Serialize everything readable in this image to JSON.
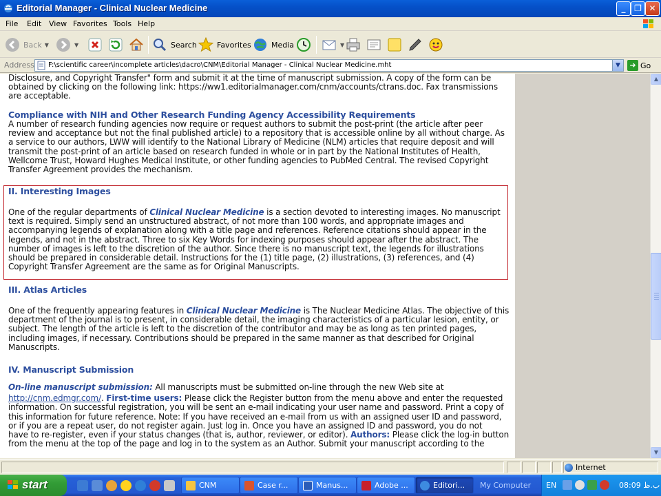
{
  "window": {
    "title": "Editorial Manager - Clinical Nuclear Medicine",
    "min_glyph": "_",
    "max_glyph": "❐",
    "close_glyph": "✕"
  },
  "menu": [
    "File",
    "Edit",
    "View",
    "Favorites",
    "Tools",
    "Help"
  ],
  "toolbar": {
    "back": "Back",
    "search": "Search",
    "favorites": "Favorites",
    "media": "Media"
  },
  "address": {
    "label": "Address",
    "url": "F:\\scientific career\\incomplete articles\\dacro\\CNM\\Editorial Manager - Clinical Nuclear Medicine.mht",
    "go": "Go"
  },
  "content": {
    "intro_lines": [
      "Disclosure, and Copyright Transfer\" form and submit it at the time of manuscript submission. A copy of the form can be",
      "obtained by clicking on the following link: https://ww1.editorialmanager.com/cnm/accounts/ctrans.doc. Fax transmissions",
      "are acceptable."
    ],
    "compliance": {
      "heading": "Compliance with NIH and Other Research Funding Agency Accessibility Requirements",
      "lines": [
        "A number of research funding agencies now require or request authors to submit the post-print (the article after peer",
        "review and acceptance but not the final published article) to a repository that is accessible online by all without charge. As",
        "a service to our authors, LWW will identify to the National Library of Medicine (NLM) articles that require deposit and will",
        "transmit the post-print of an article based on research funded in whole or in part by the National Institutes of Health,",
        "Wellcome Trust, Howard Hughes Medical Institute, or other funding agencies to PubMed Central. The revised Copyright",
        "Transfer Agreement provides the mechanism."
      ]
    },
    "interesting": {
      "heading": "II. Interesting Images",
      "first_pre": "One of the regular departments of ",
      "journal": "Clinical Nuclear Medicine",
      "first_post": " is a section devoted to interesting images. No manuscript",
      "lines": [
        "text is required. Simply send an unstructured abstract, of not more than 100 words, and appropriate images and",
        "accompanying legends of explanation along with a title page and references. Reference citations should appear in the",
        "legends, and not in the abstract. Three to six Key Words for indexing purposes should appear after the abstract. The",
        "number of images is left to the discretion of the author. Since there is no manuscript text, the legends for illustrations",
        "should be prepared in considerable detail. Instructions for the (1) title page, (2) illustrations, (3) references, and (4)",
        "Copyright Transfer Agreement are the same as for Original Manuscripts."
      ]
    },
    "atlas": {
      "heading": "III. Atlas Articles",
      "first_pre": "One of the frequently appearing features in ",
      "journal": "Clinical Nuclear Medicine",
      "first_post": " is The Nuclear Medicine Atlas. The objective of this",
      "lines": [
        "department of the journal is to present, in considerable detail, the imaging characteristics of a particular lesion, entity, or",
        "subject. The length of the article is left to the discretion of the contributor and may be as long as ten printed pages,",
        "including images, if necessary. Contributions should be prepared in the same manner as that described for Original",
        "Manuscripts."
      ]
    },
    "submission": {
      "heading": "IV. Manuscript Submission",
      "online_label": "On-line manuscript submission:",
      "online_text": " All manuscripts must be submitted on-line through the new Web site at",
      "url": "http://cnm.edmgr.com/",
      "first_time_pre": ". ",
      "first_time_label": "First-time users:",
      "first_time_text": " Please click the Register button from the menu above and enter the requested",
      "lines": [
        "information. On successful registration, you will be sent an e-mail indicating your user name and password. Print a copy of",
        "this information for future reference. Note: If you have received an e-mail from us with an assigned user ID and password,",
        "or if you are a repeat user, do not register again. Just log in. Once you have an assigned ID and password, you do not"
      ],
      "authors_pre": "have to re-register, even if your status changes (that is, author, reviewer, or editor). ",
      "authors_label": "Authors:",
      "authors_text": " Please click the log-in button",
      "last_line": "from the menu at the top of the page and log in to the system as an Author. Submit your manuscript according to the"
    }
  },
  "status": {
    "zone": "Internet"
  },
  "taskbar": {
    "start": "start",
    "tasks": [
      "CNM",
      "Case r...",
      "Manus...",
      "Adobe ...",
      "Editori..."
    ],
    "my_computer": "My Computer",
    "lang": "EN",
    "clock": "08:09 ب.ظ"
  }
}
